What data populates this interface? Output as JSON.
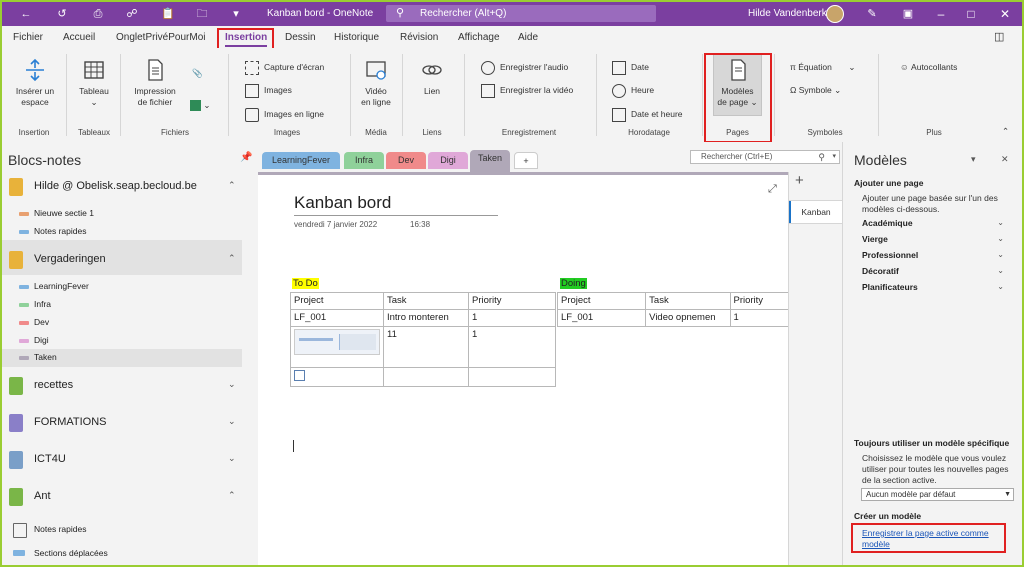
{
  "titlebar": {
    "doc_title": "Kanban bord  -  OneNote",
    "search_placeholder": "Rechercher (Alt+Q)",
    "user_name": "Hilde Vandenberk",
    "bg_color": "#7b3fa0"
  },
  "menu": {
    "tabs": [
      "Fichier",
      "Accueil",
      "OngletPrivéPourMoi",
      "Insertion",
      "Dessin",
      "Historique",
      "Révision",
      "Affichage",
      "Aide"
    ],
    "active": "Insertion"
  },
  "ribbon": {
    "insert_space": [
      "Insérer un",
      "espace"
    ],
    "table": "Tableau",
    "print_file": [
      "Impression",
      "de fichier"
    ],
    "screenshot": "Capture d'écran",
    "images": "Images",
    "online_images": "Images en ligne",
    "video_online": [
      "Vidéo",
      "en ligne"
    ],
    "link": "Lien",
    "record_audio": "Enregistrer l'audio",
    "record_video": "Enregistrer la vidéo",
    "date": "Date",
    "time": "Heure",
    "date_time": "Date et heure",
    "page_templates": [
      "Modèles",
      "de page"
    ],
    "equation": "Équation",
    "symbol": "Symbole",
    "stickers": "Autocollants",
    "groups": {
      "insert": "Insertion",
      "tables": "Tableaux",
      "files": "Fichiers",
      "images": "Images",
      "media": "Média",
      "links": "Liens",
      "recording": "Enregistrement",
      "timestamp": "Horodatage",
      "pages": "Pages",
      "symbols": "Symboles",
      "more": "Plus"
    }
  },
  "notebooks": {
    "title": "Blocs-notes",
    "nb1": {
      "name": "Hilde @ Obelisk.seap.becloud.be",
      "color": "#e8b23a",
      "sections": [
        "Nieuwe sectie 1",
        "Notes rapides"
      ]
    },
    "nb2": {
      "name": "Vergaderingen",
      "color": "#e8b23a",
      "sections": [
        "LearningFever",
        "Infra",
        "Dev",
        "Digi",
        "Taken"
      ]
    },
    "nb3": {
      "name": "recettes",
      "color": "#7ab648"
    },
    "nb4": {
      "name": "FORMATIONS",
      "color": "#8a7fc8"
    },
    "nb5": {
      "name": "ICT4U",
      "color": "#7a9fc8"
    },
    "nb6": {
      "name": "Ant",
      "color": "#7ab648"
    },
    "quick_notes": "Notes rapides",
    "moved_sections": "Sections déplacées"
  },
  "section_tabs": {
    "tabs": [
      "LearningFever",
      "Infra",
      "Dev",
      "Digi",
      "Taken"
    ],
    "colors": [
      "#7fb3e0",
      "#8fd19a",
      "#f08a8a",
      "#e0a8d8",
      "#b0a8b8"
    ],
    "active": "Taken",
    "add_label": "+"
  },
  "page_search": {
    "placeholder": "Rechercher (Ctrl+E)"
  },
  "page": {
    "title": "Kanban bord",
    "date": "vendredi 7 janvier 2022",
    "time": "16:38",
    "todo": {
      "label": "To Do",
      "highlight": "#ffff00",
      "headers": [
        "Project",
        "Task",
        "Priority"
      ],
      "rows": [
        [
          "LF_001",
          "Intro monteren",
          "1"
        ],
        [
          "",
          "11",
          "1"
        ]
      ]
    },
    "doing": {
      "label": "Doing",
      "highlight": "#22cc22",
      "headers": [
        "Project",
        "Task",
        "Priority"
      ],
      "rows": [
        [
          "LF_001",
          "Video opnemen",
          "1"
        ]
      ]
    }
  },
  "pages_pane": {
    "page": "Kanban",
    "add": "+"
  },
  "models": {
    "title": "Modèles",
    "add_page": "Ajouter une page",
    "add_page_desc": "Ajouter une page basée sur l'un des modèles ci-dessous.",
    "categories": [
      "Académique",
      "Vierge",
      "Professionnel",
      "Décoratif",
      "Planificateurs"
    ],
    "always_use": "Toujours utiliser un modèle spécifique",
    "always_use_desc": "Choisissez le modèle que vous voulez utiliser pour toutes les nouvelles pages de la section active.",
    "default_select": "Aucun modèle par défaut",
    "create": "Créer un modèle",
    "save_link": "Enregistrer la page active comme modèle"
  },
  "icons": [
    "back-icon",
    "undo-icon",
    "print-icon",
    "link-icon",
    "clipboard-icon",
    "folder-icon",
    "search-icon",
    "pen-icon",
    "restore-icon",
    "pin-icon",
    "expand-icon",
    "close-icon"
  ]
}
